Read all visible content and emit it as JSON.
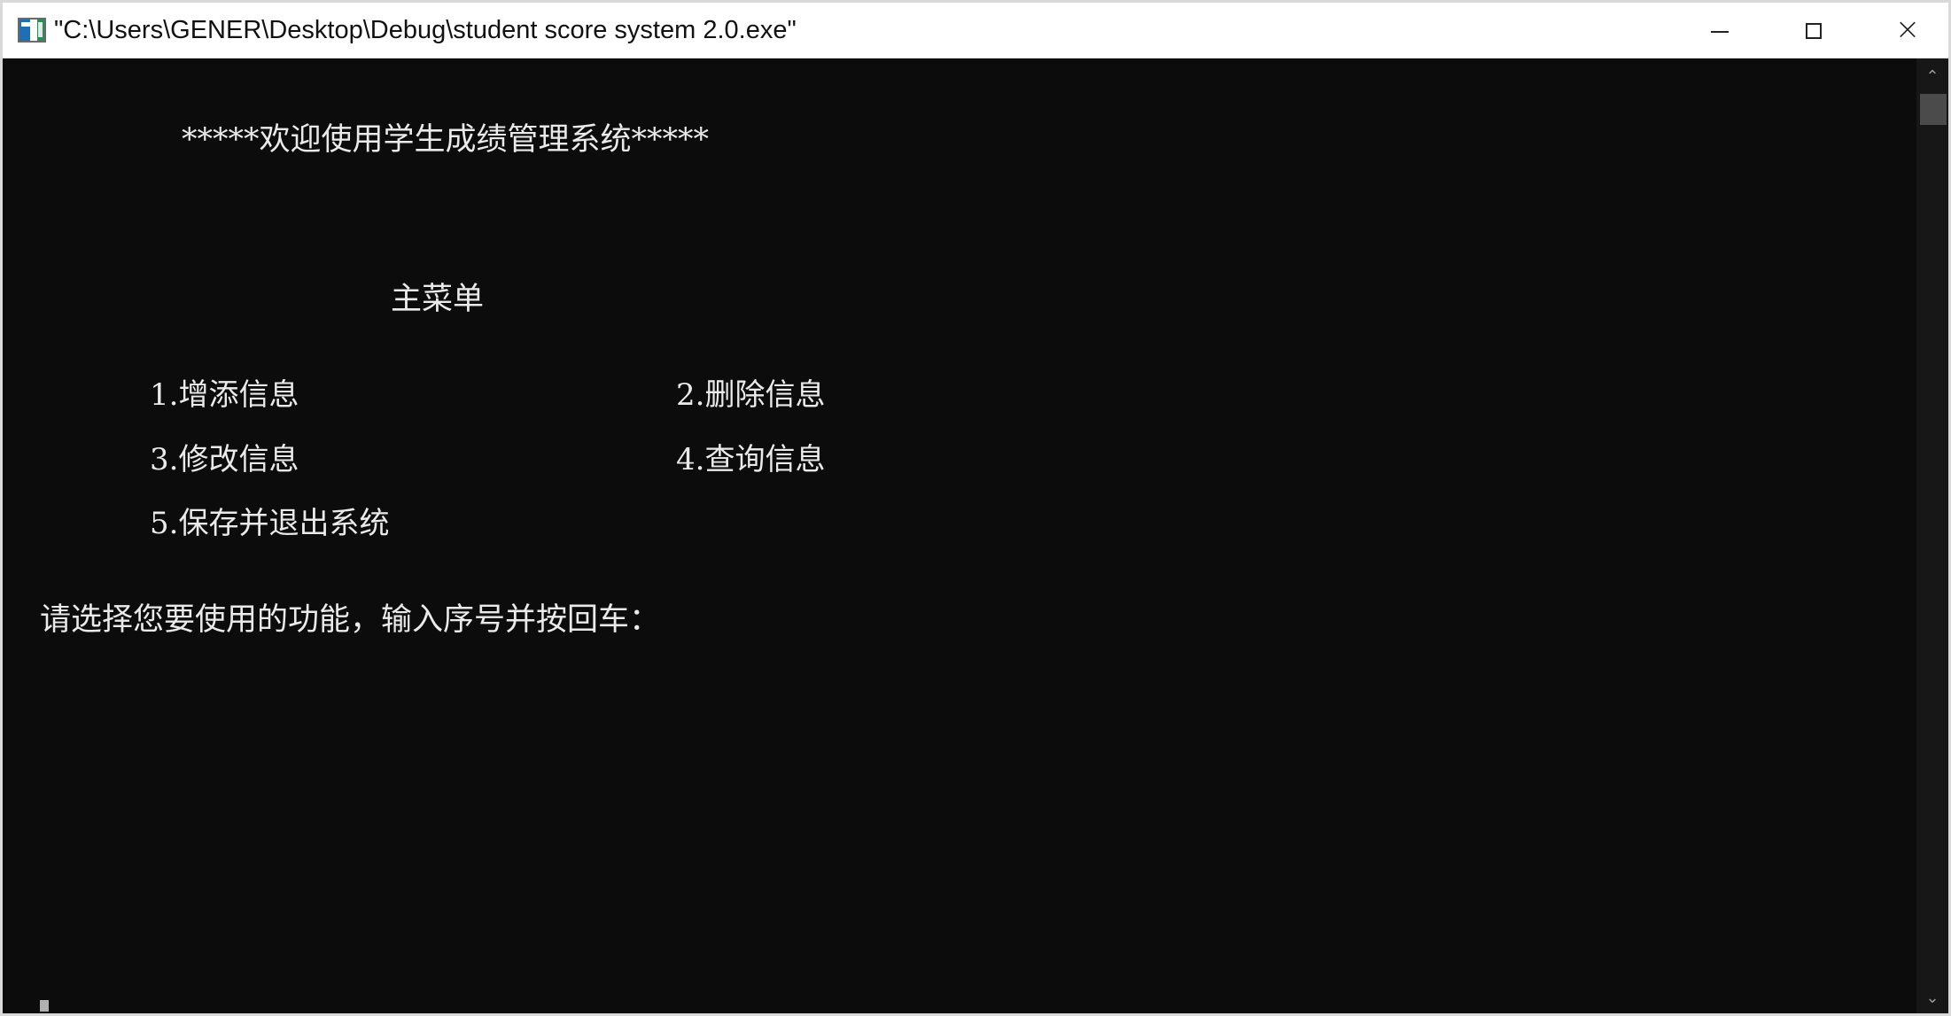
{
  "window": {
    "title": "\"C:\\Users\\GENER\\Desktop\\Debug\\student score system 2.0.exe\""
  },
  "console": {
    "welcome": "*****欢迎使用学生成绩管理系统*****",
    "menu_title": "主菜单",
    "menu_items": [
      "1.增添信息",
      "2.删除信息",
      "3.修改信息",
      "4.查询信息",
      "5.保存并退出系统"
    ],
    "prompt": "请选择您要使用的功能，输入序号并按回车："
  },
  "colors": {
    "console_background": "#0c0c0c",
    "console_text": "#eaeaea",
    "titlebar_background": "#ffffff",
    "scrollbar_thumb": "#4b4b4b"
  },
  "icons": {
    "app": "console-window-icon",
    "minimize": "minimize-icon",
    "maximize": "maximize-icon",
    "close": "close-icon",
    "scroll_up": "scroll-up-arrow-icon",
    "scroll_down": "scroll-down-arrow-icon"
  }
}
